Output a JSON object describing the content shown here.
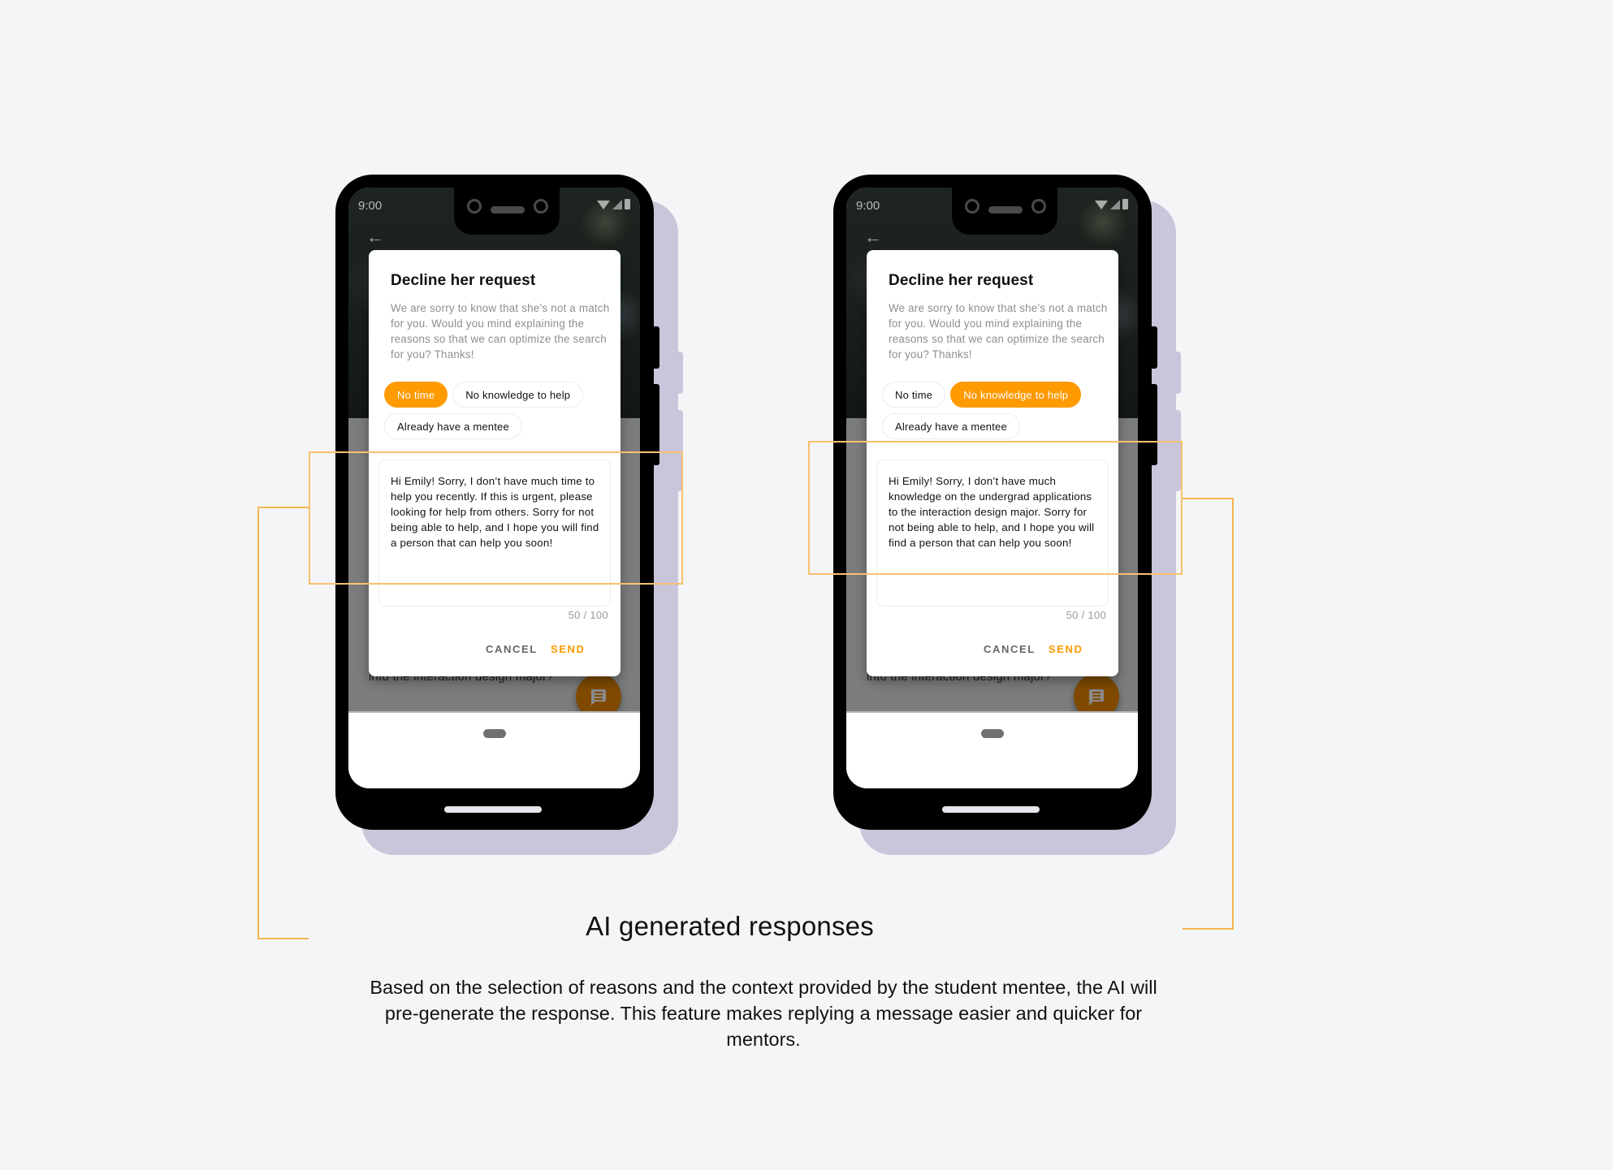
{
  "phones": [
    {
      "status_time": "9:00",
      "dialog": {
        "title": "Decline her request",
        "body": "We are sorry to know that she’s not a match for you. Would you mind explaining the reasons so that we can optimize the search for you? Thanks!",
        "chips": [
          {
            "label": "No time",
            "selected": true
          },
          {
            "label": "No knowledge to help",
            "selected": false
          },
          {
            "label": "Already have a mentee",
            "selected": false
          }
        ],
        "reply": "Hi Emily! Sorry, I don’t have much time to help you recently. If this is urgent, please looking for help from others. Sorry for not being able to help, and I hope you will find a person that can help you soon!",
        "counter": "50 / 100",
        "cancel_label": "CANCEL",
        "send_label": "SEND"
      },
      "behind_text": "into the interaction design major?"
    },
    {
      "status_time": "9:00",
      "dialog": {
        "title": "Decline her request",
        "body": "We are sorry to know that she’s not a match for you. Would you mind explaining the reasons so that we can optimize the search for you? Thanks!",
        "chips": [
          {
            "label": "No time",
            "selected": false
          },
          {
            "label": "No knowledge to help",
            "selected": true
          },
          {
            "label": "Already have a mentee",
            "selected": false
          }
        ],
        "reply": "Hi Emily! Sorry, I don’t have much knowledge on the undergrad applications to the interaction design major. Sorry for not being able to help, and I hope you will find a person that can help you soon!",
        "counter": "50 / 100",
        "cancel_label": "CANCEL",
        "send_label": "SEND"
      },
      "behind_text": "into the interaction design major?"
    }
  ],
  "caption": {
    "title": "AI generated responses",
    "body": "Based on the selection of reasons and the context provided by the student mentee, the AI will pre-generate the response. This feature makes replying a message easier and quicker for mentors."
  },
  "colors": {
    "accent": "#ff9a00",
    "highlight": "#f7c16f",
    "shadow": "#c8c6db",
    "background": "#f4f5f7"
  }
}
